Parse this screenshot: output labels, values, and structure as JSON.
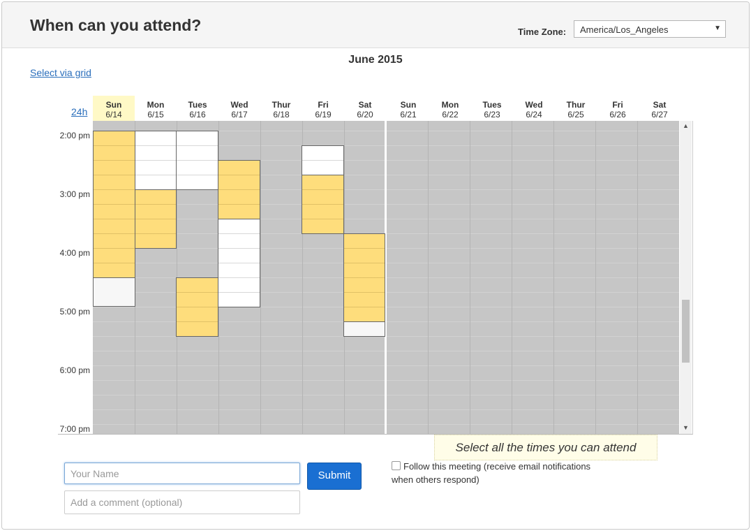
{
  "header": {
    "title": "When can you attend?",
    "timezone_label": "Time Zone:",
    "timezone_value": "America/Los_Angeles"
  },
  "calendar": {
    "month": "June 2015",
    "select_via_grid": "Select via grid",
    "toggle_24h": "24h",
    "days": [
      {
        "name": "Sun",
        "date": "6/14"
      },
      {
        "name": "Mon",
        "date": "6/15"
      },
      {
        "name": "Tues",
        "date": "6/16"
      },
      {
        "name": "Wed",
        "date": "6/17"
      },
      {
        "name": "Thur",
        "date": "6/18"
      },
      {
        "name": "Fri",
        "date": "6/19"
      },
      {
        "name": "Sat",
        "date": "6/20"
      },
      {
        "name": "Sun",
        "date": "6/21"
      },
      {
        "name": "Mon",
        "date": "6/22"
      },
      {
        "name": "Tues",
        "date": "6/23"
      },
      {
        "name": "Wed",
        "date": "6/24"
      },
      {
        "name": "Thur",
        "date": "6/25"
      },
      {
        "name": "Fri",
        "date": "6/26"
      },
      {
        "name": "Sat",
        "date": "6/27"
      }
    ],
    "times": [
      "2:00 pm",
      "3:00 pm",
      "4:00 pm",
      "5:00 pm",
      "6:00 pm",
      "7:00 pm"
    ]
  },
  "instruction": "Select all the times you can attend",
  "form": {
    "name_placeholder": "Your Name",
    "comment_placeholder": "Add a comment (optional)",
    "submit_label": "Submit",
    "follow_label": "Follow this meeting (receive email notifications when others respond)"
  },
  "colors": {
    "available": "#fedd7c",
    "open": "#ffffff",
    "unavailable": "#c6c6c6",
    "accent": "#1a6fd2"
  }
}
